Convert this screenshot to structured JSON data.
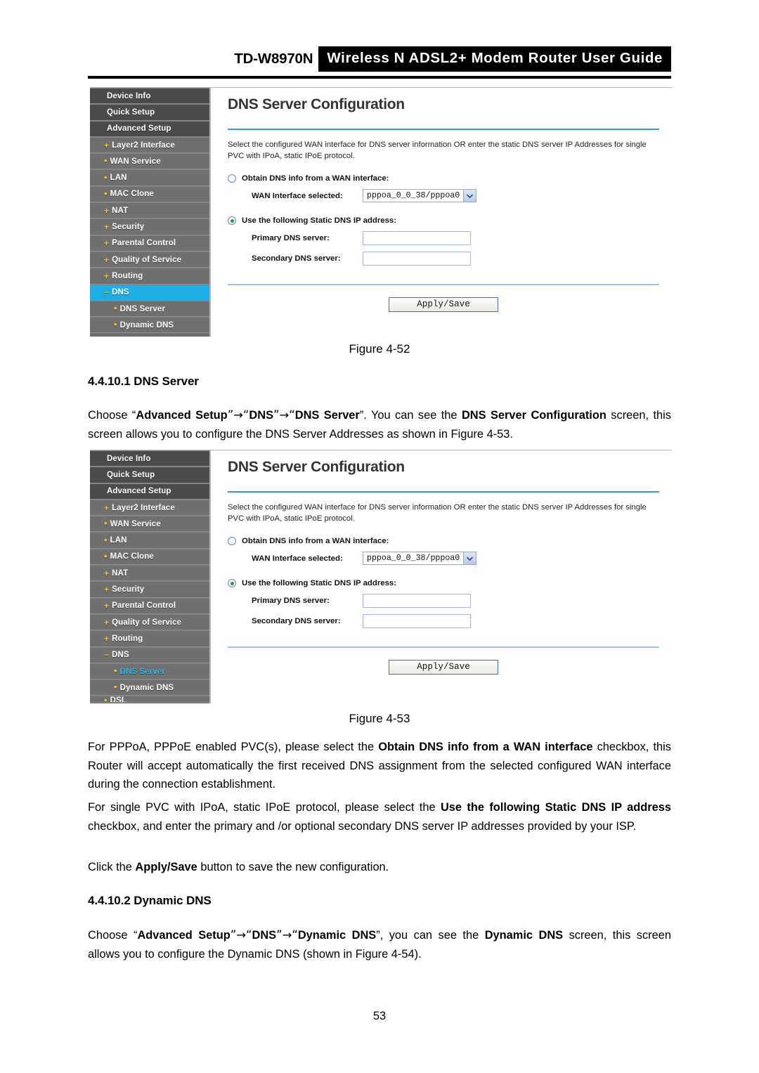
{
  "header": {
    "model": "TD-W8970N",
    "banner": "Wireless N ADSL2+ Modem Router User Guide"
  },
  "screenshot_one": {
    "sidebar": {
      "items": [
        {
          "label": "Device Info",
          "level": "top",
          "marker": "",
          "state": "normal"
        },
        {
          "label": "Quick Setup",
          "level": "top",
          "marker": "",
          "state": "normal"
        },
        {
          "label": "Advanced Setup",
          "level": "top",
          "marker": "",
          "state": "normal"
        },
        {
          "label": "Layer2 Interface",
          "level": "lvl1",
          "marker": "+",
          "state": "normal"
        },
        {
          "label": "WAN Service",
          "level": "lvl1",
          "marker": "•",
          "state": "normal"
        },
        {
          "label": "LAN",
          "level": "lvl1",
          "marker": "•",
          "state": "normal"
        },
        {
          "label": "MAC Clone",
          "level": "lvl1",
          "marker": "•",
          "state": "normal"
        },
        {
          "label": "NAT",
          "level": "lvl1",
          "marker": "+",
          "state": "normal"
        },
        {
          "label": "Security",
          "level": "lvl1",
          "marker": "+",
          "state": "normal"
        },
        {
          "label": "Parental Control",
          "level": "lvl1",
          "marker": "+",
          "state": "normal"
        },
        {
          "label": "Quality of Service",
          "level": "lvl1",
          "marker": "+",
          "state": "normal"
        },
        {
          "label": "Routing",
          "level": "lvl1",
          "marker": "+",
          "state": "normal"
        },
        {
          "label": "DNS",
          "level": "lvl1",
          "marker": "−",
          "state": "selected-bg"
        },
        {
          "label": "DNS Server",
          "level": "lvl2",
          "marker": "•",
          "state": "normal"
        },
        {
          "label": "Dynamic DNS",
          "level": "lvl2",
          "marker": "•",
          "state": "normal"
        }
      ]
    },
    "panel": {
      "title": "DNS Server Configuration",
      "description": "Select the configured WAN interface for DNS server information OR enter the static DNS server IP Addresses for single PVC with IPoA, static IPoE protocol.",
      "option_wan_label": "Obtain DNS info from a WAN interface:",
      "option_wan_selected": false,
      "wan_interface_label": "WAN Interface selected:",
      "wan_interface_value": "pppoa_0_0_38/pppoa0",
      "option_static_label": "Use the following Static DNS IP address:",
      "option_static_selected": true,
      "primary_dns_label": "Primary DNS server:",
      "primary_dns_value": "",
      "secondary_dns_label": "Secondary DNS server:",
      "secondary_dns_value": "",
      "apply_label": "Apply/Save"
    }
  },
  "screenshot_two": {
    "sidebar": {
      "items": [
        {
          "label": "Device Info",
          "level": "top",
          "marker": "",
          "state": "normal"
        },
        {
          "label": "Quick Setup",
          "level": "top",
          "marker": "",
          "state": "normal"
        },
        {
          "label": "Advanced Setup",
          "level": "top",
          "marker": "",
          "state": "normal"
        },
        {
          "label": "Layer2 Interface",
          "level": "lvl1",
          "marker": "+",
          "state": "normal"
        },
        {
          "label": "WAN Service",
          "level": "lvl1",
          "marker": "•",
          "state": "normal"
        },
        {
          "label": "LAN",
          "level": "lvl1",
          "marker": "•",
          "state": "normal"
        },
        {
          "label": "MAC Clone",
          "level": "lvl1",
          "marker": "•",
          "state": "normal"
        },
        {
          "label": "NAT",
          "level": "lvl1",
          "marker": "+",
          "state": "normal"
        },
        {
          "label": "Security",
          "level": "lvl1",
          "marker": "+",
          "state": "normal"
        },
        {
          "label": "Parental Control",
          "level": "lvl1",
          "marker": "+",
          "state": "normal"
        },
        {
          "label": "Quality of Service",
          "level": "lvl1",
          "marker": "+",
          "state": "normal"
        },
        {
          "label": "Routing",
          "level": "lvl1",
          "marker": "+",
          "state": "normal"
        },
        {
          "label": "DNS",
          "level": "lvl1",
          "marker": "−",
          "state": "normal"
        },
        {
          "label": "DNS Server",
          "level": "lvl2",
          "marker": "•",
          "state": "selected-text"
        },
        {
          "label": "Dynamic DNS",
          "level": "lvl2",
          "marker": "•",
          "state": "normal"
        },
        {
          "label": "DSL",
          "level": "lvl1",
          "marker": "•",
          "state": "clipped"
        }
      ]
    },
    "panel": {
      "title": "DNS Server Configuration",
      "description": "Select the configured WAN interface for DNS server information OR enter the static DNS server IP Addresses for single PVC with IPoA, static IPoE protocol.",
      "option_wan_label": "Obtain DNS info from a WAN interface:",
      "option_wan_selected": false,
      "wan_interface_label": "WAN Interface selected:",
      "wan_interface_value": "pppoa_0_0_38/pppoa0",
      "option_static_label": "Use the following Static DNS IP address:",
      "option_static_selected": true,
      "primary_dns_label": "Primary DNS server:",
      "primary_dns_value": "",
      "secondary_dns_label": "Secondary DNS server:",
      "secondary_dns_value": "",
      "apply_label": "Apply/Save"
    }
  },
  "body": {
    "figure_52": "Figure 4-52",
    "figure_53": "Figure 4-53",
    "heading_dns_server": "4.4.10.1 DNS Server",
    "heading_dynamic_dns": "4.4.10.2 Dynamic DNS",
    "para_choose_dns_server": {
      "t1": "Choose “",
      "b1": "Advanced Setup",
      "t2": "”→“",
      "b2": "DNS",
      "t3": "”→“",
      "b3": "DNS Server",
      "t4": "”. You can see the ",
      "b4": "DNS Server Configuration",
      "t5": " screen, this screen allows you to configure the DNS Server Addresses as shown in Figure 4-53."
    },
    "para_pppoa": {
      "t1": "For PPPoA, PPPoE enabled PVC(s), please select the ",
      "b1": "Obtain DNS info from a WAN interface",
      "t2": " checkbox, this Router will accept automatically the first received DNS assignment from the selected configured WAN interface during the connection establishment."
    },
    "para_single_pvc": {
      "t1": "For single PVC with IPoA, static IPoE protocol, please select the ",
      "b1": "Use the following Static DNS IP address",
      "t2": " checkbox, and enter the primary and /or optional secondary DNS server IP addresses provided by your ISP."
    },
    "para_apply": {
      "t1": "Click the ",
      "b1": "Apply/Save",
      "t2": " button to save the new configuration."
    },
    "para_choose_dynamic_dns": {
      "t1": "Choose “",
      "b1": "Advanced Setup",
      "t2": "”→“",
      "b2": "DNS",
      "t3": "”→“",
      "b3": "Dynamic DNS",
      "t4": "”, you can see the ",
      "b4": "Dynamic DNS",
      "t5": " screen, this screen allows you to configure the Dynamic DNS (shown in Figure 4-54)."
    }
  },
  "footer": {
    "page_number": "53"
  },
  "colors": {
    "accent_blue": "#1bade4",
    "sidebar_bg": "#6f6f6f",
    "sidebar_top_bg": "#4b4b4b",
    "marker_yellow": "#f5c518",
    "panel_rule": "#3b9bc4",
    "radio_green": "#1e9e3a"
  }
}
